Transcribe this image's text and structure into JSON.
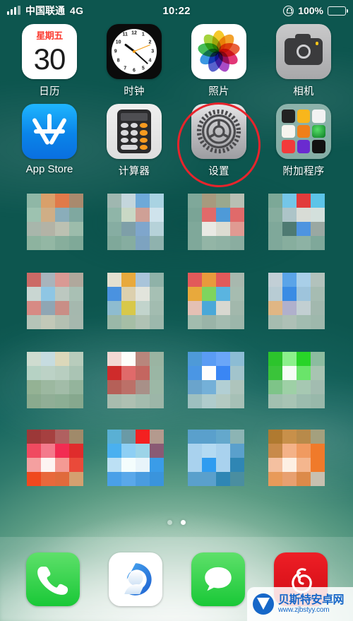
{
  "status_bar": {
    "signal_icon": "signal-bars-icon",
    "signal_bars": 3,
    "carrier": "中国联通",
    "network": "4G",
    "time": "10:22",
    "rotation_lock_icon": "rotation-lock-icon",
    "battery_percent": "100%",
    "battery_icon": "battery-full-icon"
  },
  "home_screen": {
    "rows": [
      {
        "apps": [
          {
            "name": "calendar",
            "label": "日历",
            "weekday": "星期五",
            "day": "30"
          },
          {
            "name": "clock",
            "label": "时钟",
            "time": "10:22"
          },
          {
            "name": "photos",
            "label": "照片"
          },
          {
            "name": "camera",
            "label": "相机"
          }
        ]
      },
      {
        "apps": [
          {
            "name": "app-store",
            "label": "App Store"
          },
          {
            "name": "calculator",
            "label": "计算器"
          },
          {
            "name": "settings",
            "label": "设置",
            "highlighted": true
          },
          {
            "name": "extras-folder",
            "label": "附加程序"
          }
        ]
      }
    ],
    "blurred_note": "下方四行应用图标已被马赛克处理",
    "page_dots": {
      "count": 2,
      "active_index": 1
    }
  },
  "annotation": {
    "type": "circle-highlight",
    "target": "设置",
    "color": "#e8242c"
  },
  "dock": {
    "apps": [
      {
        "name": "phone",
        "label": "电话",
        "color": "#19c837"
      },
      {
        "name": "qq-browser",
        "label": "QQ浏览器",
        "color": "#1f7fe0"
      },
      {
        "name": "messages",
        "label": "信息",
        "color": "#19c837"
      },
      {
        "name": "netease-music",
        "label": "网易云音乐",
        "color": "#d00b14"
      }
    ]
  },
  "watermark": {
    "title": "贝斯特安卓网",
    "url": "www.zjbstyy.com"
  },
  "colors": {
    "accent_red": "#e8242c",
    "calendar_red": "#fb3b30",
    "appstore_blue": "#0a84e8",
    "green": "#19c837"
  }
}
